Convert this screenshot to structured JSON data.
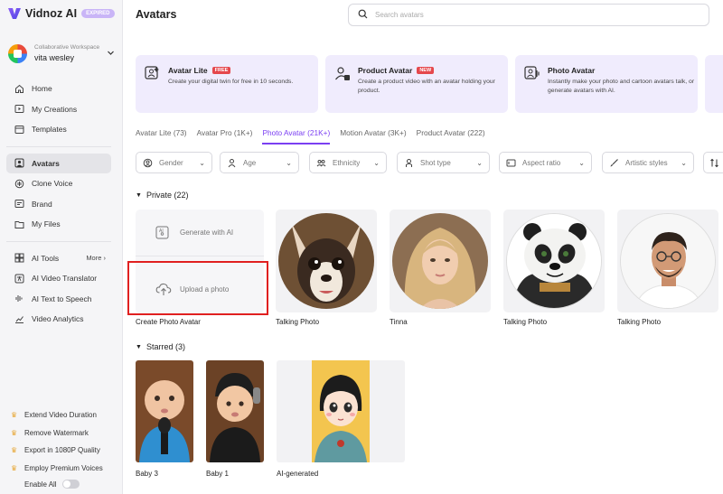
{
  "brand": {
    "name": "Vidnoz AI",
    "badge": "EXPIRED"
  },
  "workspace": {
    "label": "Collaborative Workspace",
    "name": "vita wesley"
  },
  "nav": {
    "main": [
      {
        "label": "Home",
        "icon": "home-icon"
      },
      {
        "label": "My Creations",
        "icon": "play-square-icon"
      },
      {
        "label": "Templates",
        "icon": "templates-icon"
      }
    ],
    "assets": [
      {
        "label": "Avatars",
        "icon": "avatar-icon",
        "active": true
      },
      {
        "label": "Clone Voice",
        "icon": "voice-icon"
      },
      {
        "label": "Brand",
        "icon": "brand-icon"
      },
      {
        "label": "My Files",
        "icon": "folder-icon"
      }
    ],
    "tools": [
      {
        "label": "AI Tools",
        "icon": "ai-tools-icon",
        "more": "More"
      },
      {
        "label": "AI Video Translator",
        "icon": "translate-icon"
      },
      {
        "label": "AI Text to Speech",
        "icon": "tts-icon"
      },
      {
        "label": "Video Analytics",
        "icon": "analytics-icon"
      }
    ]
  },
  "upsell": [
    "Extend Video Duration",
    "Remove Watermark",
    "Export in 1080P Quality",
    "Employ Premium Voices"
  ],
  "enable_all": "Enable All",
  "page": {
    "title": "Avatars"
  },
  "search": {
    "placeholder": "Search avatars"
  },
  "feature_cards": [
    {
      "title": "Avatar Lite",
      "tag": "FREE",
      "desc": "Create your digital twin for free in 10 seconds."
    },
    {
      "title": "Product Avatar",
      "tag": "NEW",
      "desc": "Create a product video with an avatar holding your product."
    },
    {
      "title": "Photo Avatar",
      "tag": "",
      "desc": "Instantly make your photo and cartoon avatars talk, or generate avatars with AI."
    }
  ],
  "tabs": [
    {
      "label": "Avatar Lite (73)"
    },
    {
      "label": "Avatar Pro (1K+)"
    },
    {
      "label": "Photo Avatar (21K+)",
      "active": true
    },
    {
      "label": "Motion Avatar (3K+)"
    },
    {
      "label": "Product Avatar (222)"
    }
  ],
  "filters": [
    {
      "label": "Gender",
      "icon": "gender-icon"
    },
    {
      "label": "Age",
      "icon": "age-icon"
    },
    {
      "label": "Ethnicity",
      "icon": "ethnicity-icon"
    },
    {
      "label": "Shot type",
      "icon": "shot-type-icon"
    },
    {
      "label": "Aspect ratio",
      "icon": "aspect-ratio-icon"
    },
    {
      "label": "Artistic styles",
      "icon": "brush-icon"
    }
  ],
  "private": {
    "title": "Private (22)",
    "generate_label": "Generate with AI",
    "upload_label": "Upload a photo",
    "create_caption": "Create Photo Avatar",
    "avatars": [
      {
        "caption": "Talking Photo",
        "subject": "chihuahua"
      },
      {
        "caption": "Tinna",
        "subject": "woman"
      },
      {
        "caption": "Talking Photo",
        "subject": "panda"
      },
      {
        "caption": "Talking Photo",
        "subject": "man"
      }
    ]
  },
  "starred": {
    "title": "Starred (3)",
    "items": [
      {
        "caption": "Baby 3"
      },
      {
        "caption": "Baby 1"
      },
      {
        "caption": "AI-generated"
      }
    ]
  },
  "colors": {
    "accent": "#7b3ff2",
    "card_bg": "#f0ecfd",
    "highlight": "#e02020",
    "tag_red": "#e5484d"
  }
}
